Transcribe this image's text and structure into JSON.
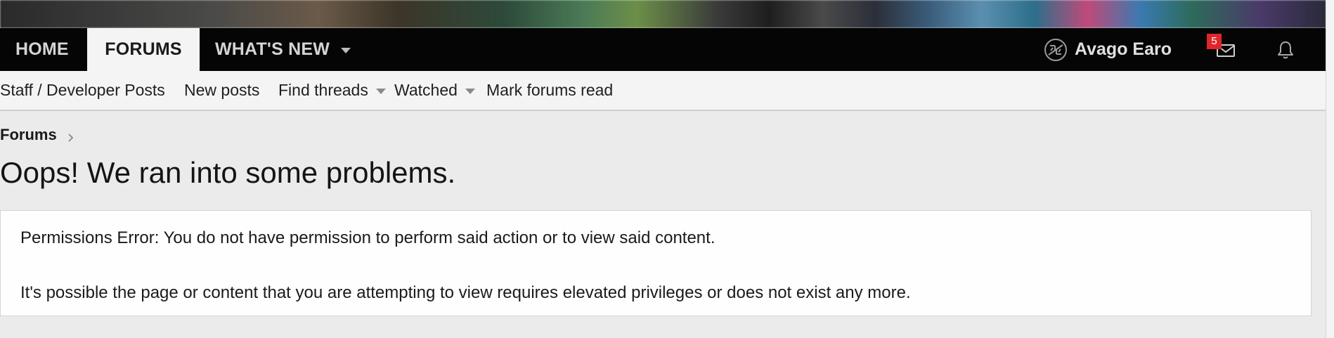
{
  "nav": {
    "tabs": [
      {
        "label": "HOME"
      },
      {
        "label": "FORUMS",
        "active": true
      },
      {
        "label": "WHAT'S NEW",
        "has_dropdown": true
      }
    ],
    "user": {
      "name": "Avago Earo",
      "avatar_icon": "avatar-logo-icon"
    },
    "inbox": {
      "icon": "mail-icon",
      "badge": "5",
      "badge_color": "#e0262c"
    },
    "alerts": {
      "icon": "bell-icon"
    }
  },
  "subnav": {
    "items": [
      {
        "label": "Staff / Developer Posts"
      },
      {
        "label": "New posts"
      },
      {
        "label": "Find threads",
        "has_dropdown": true
      },
      {
        "label": "Watched",
        "has_dropdown": true
      },
      {
        "label": "Mark forums read"
      }
    ]
  },
  "breadcrumb": {
    "items": [
      {
        "label": "Forums"
      }
    ]
  },
  "page": {
    "title": "Oops! We ran into some problems."
  },
  "error": {
    "lines": [
      "Permissions Error: You do not have permission to perform said action or to view said content.",
      "It's possible the page or content that you are attempting to view requires elevated privileges or does not exist any more."
    ]
  },
  "theme": {
    "nav_background": "#050505",
    "active_tab_background": "#f4f4f4",
    "page_background": "#ebebeb"
  }
}
